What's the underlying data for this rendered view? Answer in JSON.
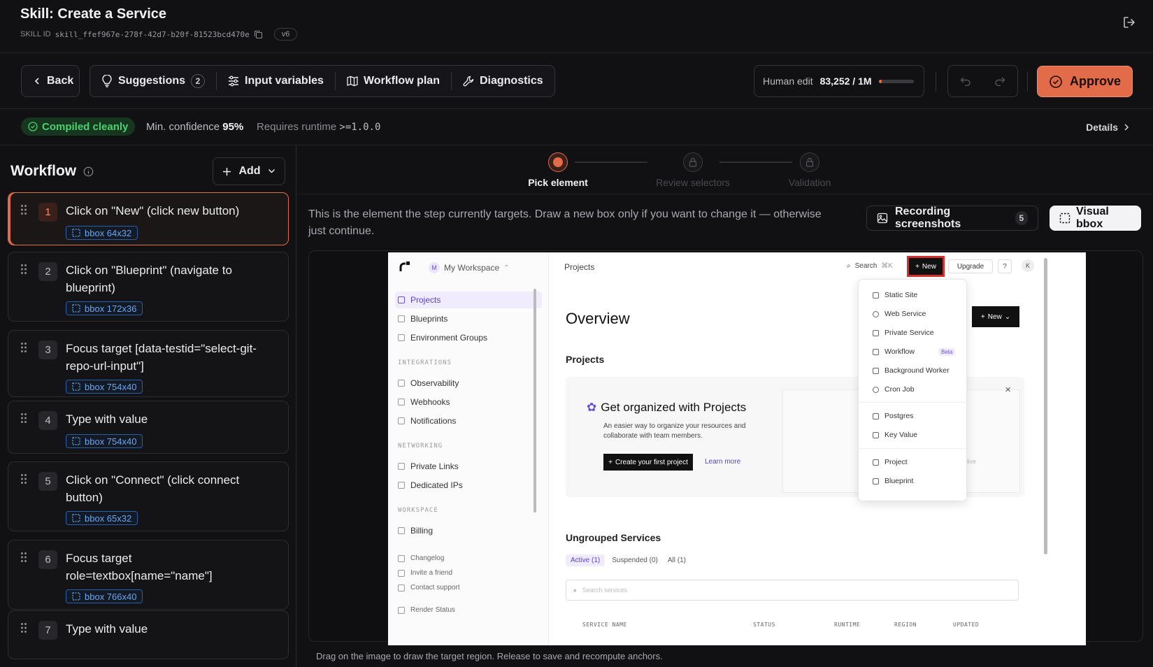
{
  "header": {
    "title": "Skill: Create a Service",
    "skill_id_label": "SKILL ID",
    "skill_id": "skill_ffef967e-278f-42d7-b20f-81523bcd470e",
    "version": "v6"
  },
  "toolbar": {
    "back": "Back",
    "suggestions": "Suggestions",
    "suggestions_count": "2",
    "input_variables": "Input variables",
    "workflow_plan": "Workflow plan",
    "diagnostics": "Diagnostics",
    "human_edit_label": "Human edit",
    "human_edit_value": "83,252 / 1M",
    "human_edit_fraction": 0.083,
    "approve": "Approve"
  },
  "status": {
    "compiled": "Compiled cleanly",
    "min_conf_label": "Min. confidence",
    "min_conf_value": "95%",
    "runtime_label": "Requires runtime",
    "runtime_value": ">=1.0.0",
    "details": "Details"
  },
  "workflow": {
    "title": "Workflow",
    "add": "Add",
    "steps": [
      {
        "num": "1",
        "text": "Click on \"New\" (click new button)",
        "bbox": "bbox 64x32"
      },
      {
        "num": "2",
        "text": "Click on \"Blueprint\" (navigate to blueprint)",
        "bbox": "bbox 172x36"
      },
      {
        "num": "3",
        "text": "Focus target [data-testid=\"select-git-repo-url-input\"]",
        "bbox": "bbox 754x40"
      },
      {
        "num": "4",
        "text": "Type with value",
        "bbox": "bbox 754x40"
      },
      {
        "num": "5",
        "text": "Click on \"Connect\" (click connect button)",
        "bbox": "bbox 65x32"
      },
      {
        "num": "6",
        "text": "Focus target role=textbox[name=\"name\"]",
        "bbox": "bbox 766x40"
      },
      {
        "num": "7",
        "text": "Type with value",
        "bbox": ""
      }
    ]
  },
  "stepper": {
    "steps": [
      "Pick element",
      "Review selectors",
      "Validation"
    ]
  },
  "panel": {
    "instruction": "This is the element the step currently targets. Draw a new box only if you want to change it — otherwise just continue.",
    "recording": "Recording screenshots",
    "recording_count": "5",
    "visual_bbox": "Visual bbox",
    "hint": "Drag on the image to draw the target region. Release to save and recompute anchors."
  },
  "screenshot": {
    "workspace_initial": "M",
    "workspace": "My Workspace",
    "nav": [
      "Projects",
      "Blueprints",
      "Environment Groups"
    ],
    "sec_integrations": "INTEGRATIONS",
    "nav_int": [
      "Observability",
      "Webhooks",
      "Notifications"
    ],
    "sec_networking": "NETWORKING",
    "nav_net": [
      "Private Links",
      "Dedicated IPs"
    ],
    "sec_workspace": "WORKSPACE",
    "nav_ws": [
      "Billing"
    ],
    "footer": [
      "Changelog",
      "Invite a friend",
      "Contact support",
      "Render Status"
    ],
    "breadcrumb": "Projects",
    "search": "Search",
    "search_kbd": "⌘K",
    "new": "New",
    "upgrade": "Upgrade",
    "avatar": "K",
    "overview": "Overview",
    "projects_h": "Projects",
    "card_title": "Get organized with Projects",
    "card_text": "An easier way to organize your resources and collaborate with team members.",
    "create_btn": "Create your first project",
    "learn": "Learn more",
    "team_link": "team",
    "new_btn2": "New",
    "menu": [
      "Static Site",
      "Web Service",
      "Private Service",
      "Workflow",
      "Background Worker",
      "Cron Job",
      "Postgres",
      "Key Value",
      "Project",
      "Blueprint"
    ],
    "beta": "Beta",
    "ungrouped": "Ungrouped Services",
    "tabs": [
      "Active (1)",
      "Suspended (0)",
      "All (1)"
    ],
    "search_services": "Search services",
    "cols": [
      "SERVICE NAME",
      "STATUS",
      "RUNTIME",
      "REGION",
      "UPDATED"
    ],
    "faded_label": "Inactive"
  },
  "colors": {
    "accent": "#e26b4a",
    "success": "#4bd16e",
    "bbox": "#6aa6f2",
    "bg": "#111113"
  }
}
